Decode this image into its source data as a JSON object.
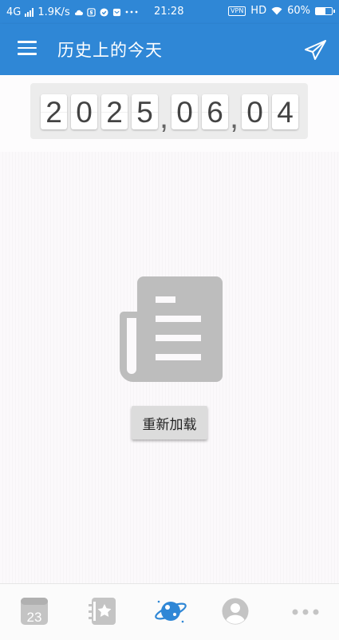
{
  "status_bar": {
    "network": "4G",
    "speed": "1.9K/s",
    "time": "21:28",
    "vpn": "VPN",
    "hd": "HD",
    "battery_text": "60%",
    "battery_level": 0.6,
    "icons": [
      "signal-icon",
      "cloud-icon",
      "s-app-icon",
      "check-circle-icon",
      "mail-icon",
      "more-dots-icon",
      "wifi-icon",
      "battery-icon"
    ]
  },
  "app_bar": {
    "title": "历史上的今天",
    "icons": [
      "menu-icon",
      "send-icon"
    ],
    "color": "#2f87d6"
  },
  "date": {
    "year_digits": [
      "2",
      "0",
      "2",
      "5"
    ],
    "month_digits": [
      "0",
      "6"
    ],
    "day_digits": [
      "0",
      "4"
    ],
    "separator": ","
  },
  "content": {
    "icon": "newspaper-icon",
    "reload_label": "重新加载"
  },
  "bottom_nav": {
    "calendar_day": "23",
    "items": [
      "calendar-icon",
      "favorites-icon",
      "planet-icon",
      "user-icon",
      "more-icon"
    ],
    "active_index": 2,
    "active_color": "#2f87d6",
    "inactive_color": "#c4c4c4"
  }
}
